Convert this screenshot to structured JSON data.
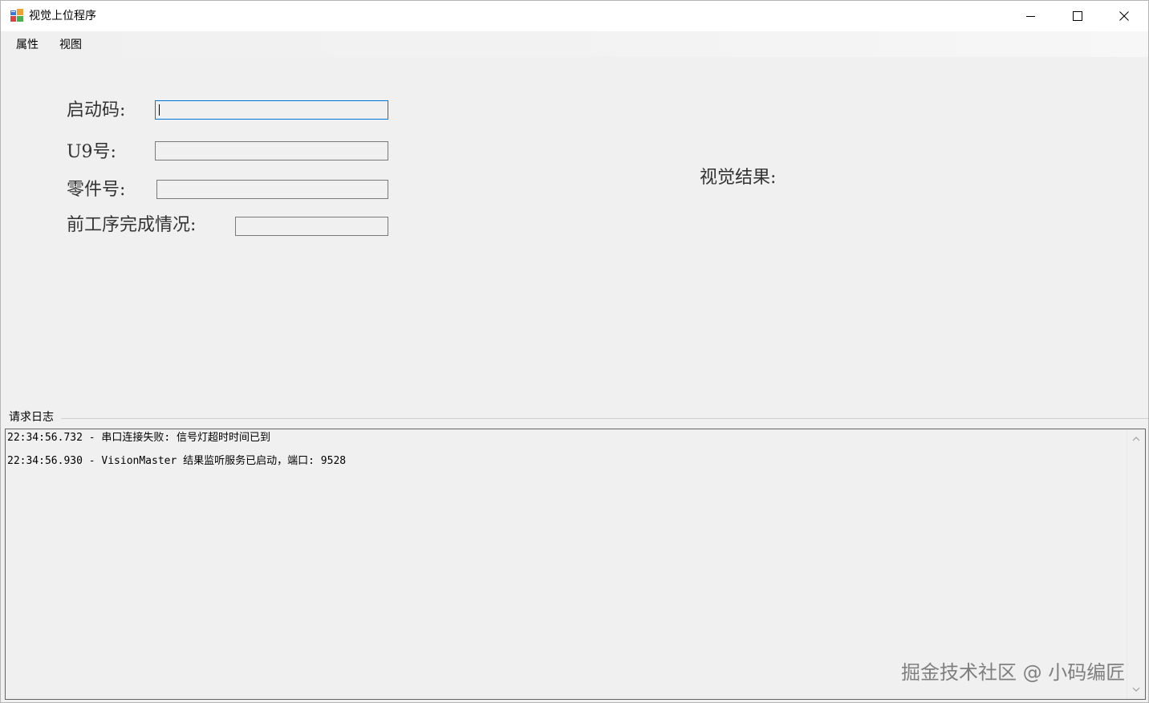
{
  "window": {
    "title": "视觉上位程序",
    "icon": "windows-forms-app-icon",
    "controls": [
      "minimize-icon",
      "maximize-icon",
      "close-icon"
    ]
  },
  "menu": {
    "items": [
      {
        "label": "属性"
      },
      {
        "label": "视图"
      }
    ]
  },
  "form": {
    "start_code_label": "启动码:",
    "start_code_value": "",
    "u9_label": "U9号:",
    "u9_value": "",
    "part_label": "零件号:",
    "part_value": "",
    "prev_process_label": "前工序完成情况:",
    "prev_process_value": ""
  },
  "vision": {
    "result_label": "视觉结果:"
  },
  "log": {
    "group_label": "请求日志",
    "lines": [
      "22:34:56.732 - 串口连接失败: 信号灯超时时间已到",
      "22:34:56.930 - VisionMaster 结果监听服务已启动，端口: 9528"
    ]
  },
  "watermark": "掘金技术社区 @ 小码编匠",
  "colors": {
    "focus_border": "#0078d7",
    "background": "#f0f0f0",
    "titlebar": "#ffffff"
  }
}
